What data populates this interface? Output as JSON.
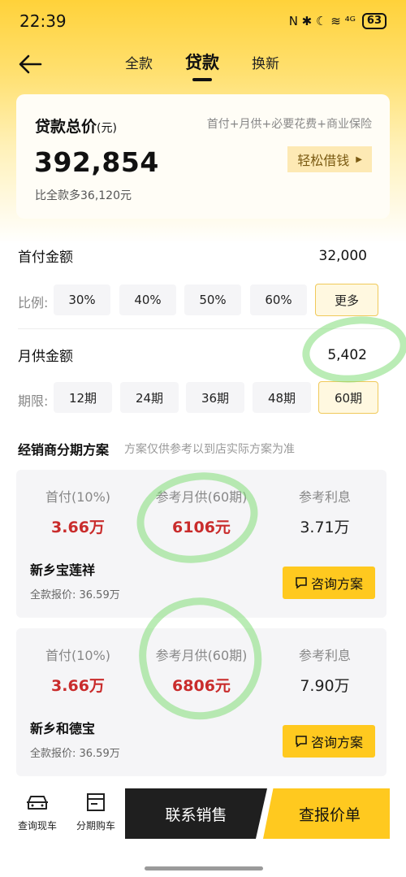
{
  "status_bar": {
    "time": "22:39",
    "icons_text": "N ✱ ☾ ≋ ⁴ᴳ",
    "battery": "63"
  },
  "nav": {
    "tabs": [
      {
        "label": "全款"
      },
      {
        "label": "贷款"
      },
      {
        "label": "换新"
      }
    ],
    "active_tab": "贷款"
  },
  "total": {
    "title": "贷款总价",
    "unit": "(元)",
    "formula": "首付+月供+必要花费+商业保险",
    "amount": "392,854",
    "compare": "比全款多36,120元",
    "easy_borrow_label": "轻松借钱"
  },
  "down_payment": {
    "label": "首付金额",
    "value": "32,000",
    "ratio_label": "比例:",
    "options": [
      "30%",
      "40%",
      "50%",
      "60%",
      "更多"
    ],
    "selected": "更多"
  },
  "monthly": {
    "label": "月供金额",
    "value": "5,402",
    "term_label": "期限:",
    "options": [
      "12期",
      "24期",
      "36期",
      "48期",
      "60期"
    ],
    "selected": "60期"
  },
  "plans_section": {
    "title": "经销商分期方案",
    "note": "方案仅供参考以到店实际方案为准"
  },
  "plans": [
    {
      "col1_label": "首付(10%)",
      "col1_value": "3.66万",
      "col2_label": "参考月供(60期)",
      "col2_value": "6106元",
      "col3_label": "参考利息",
      "col3_value": "3.71万",
      "dealer": "新乡宝莲祥",
      "price": "全款报价: 36.59万",
      "button": "咨询方案"
    },
    {
      "col1_label": "首付(10%)",
      "col1_value": "3.66万",
      "col2_label": "参考月供(60期)",
      "col2_value": "6806元",
      "col3_label": "参考利息",
      "col3_value": "7.90万",
      "dealer": "新乡和德宝",
      "price": "全款报价: 36.59万",
      "button": "咨询方案"
    }
  ],
  "bottom_bar": {
    "query_car": "查询现车",
    "installment": "分期购车",
    "contact": "联系销售",
    "quote": "查报价单"
  },
  "colors": {
    "brand_yellow": "#ffc91f",
    "price_red": "#c92c2c",
    "annotation_green": "#82dc78"
  }
}
